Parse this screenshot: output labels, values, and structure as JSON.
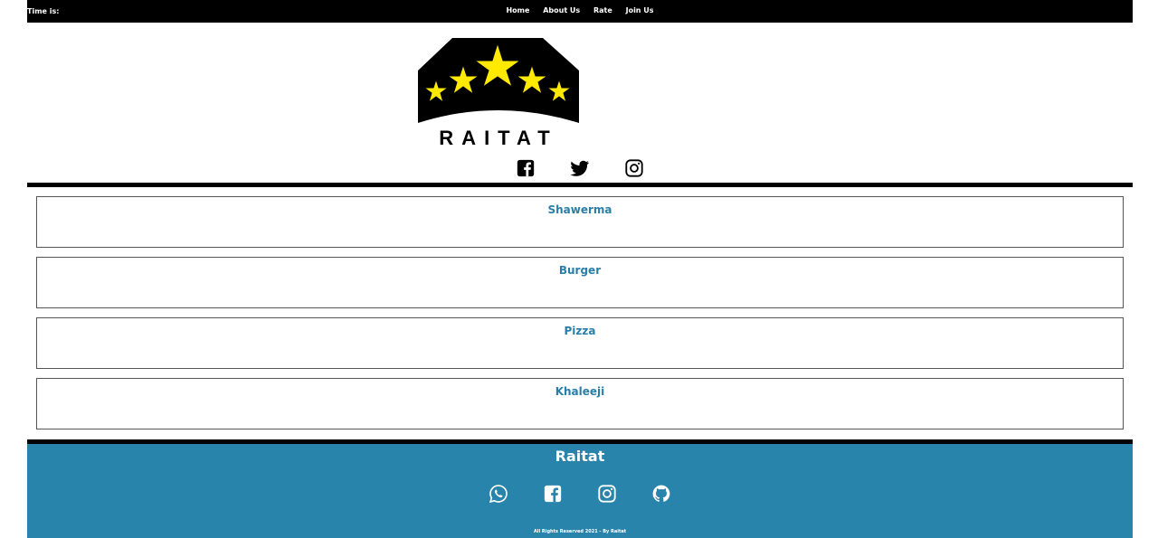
{
  "header": {
    "time_label": "Time is:",
    "nav": [
      "Home",
      "About Us",
      "Rate",
      "Join Us"
    ]
  },
  "logo": {
    "text": "RAITAT",
    "colors": {
      "shape": "#000000",
      "stars": "#ffea00"
    }
  },
  "social_top": [
    "facebook-icon",
    "twitter-icon",
    "instagram-icon"
  ],
  "categories": [
    "Shawerma",
    "Burger",
    "Pizza",
    "Khaleeji"
  ],
  "footer": {
    "brand": "Raitat",
    "social": [
      "whatsapp-icon",
      "facebook-icon",
      "instagram-icon",
      "github-icon"
    ],
    "copyright": "All Rights Reserved 2021 - By Raitat"
  },
  "colors": {
    "topbar": "#000000",
    "footer_bg": "#2884ab",
    "category_text": "#2a7ea8"
  }
}
